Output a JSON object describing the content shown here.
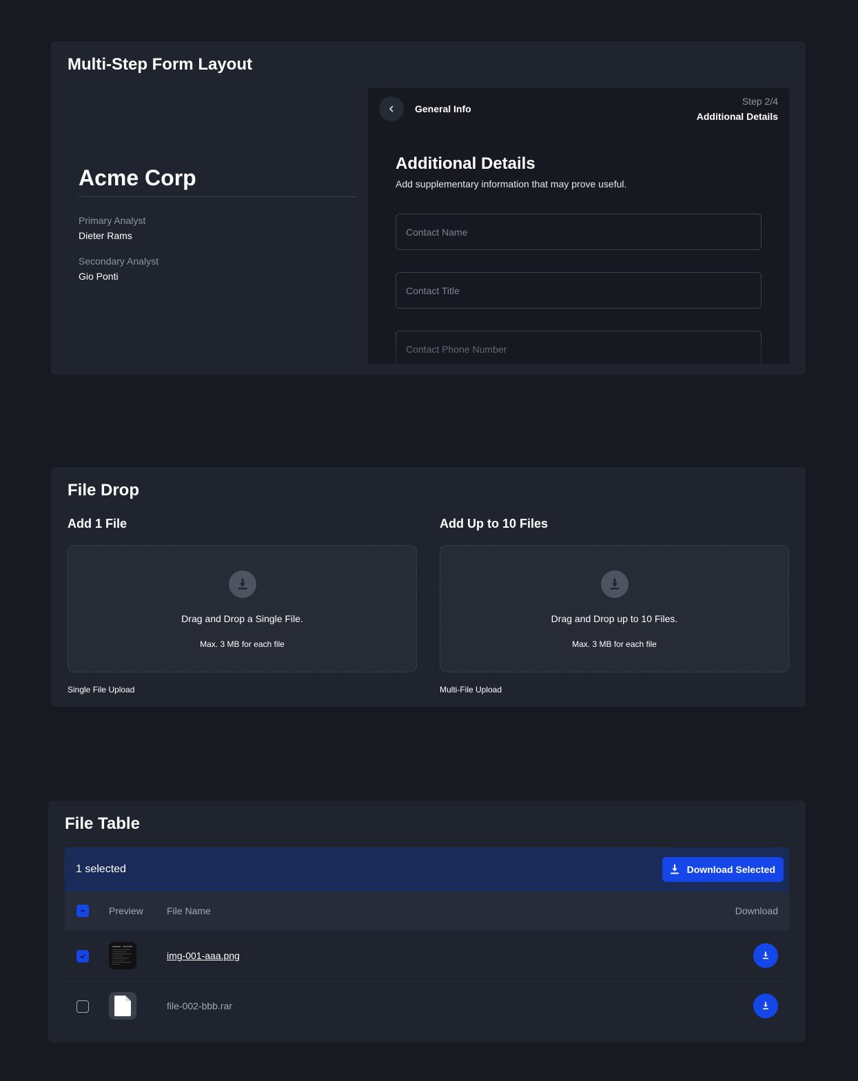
{
  "form_section": {
    "title": "Multi-Step Form Layout",
    "company": "Acme Corp",
    "analysts": [
      {
        "label": "Primary Analyst",
        "value": "Dieter Rams"
      },
      {
        "label": "Secondary Analyst",
        "value": "Gio Ponti"
      }
    ],
    "nav": {
      "back_icon": "chevron-left-icon",
      "previous_step": "General Info",
      "step_indicator": "Step 2/4",
      "current_step": "Additional Details"
    },
    "heading": "Additional Details",
    "subheading": "Add supplementary information that may prove useful.",
    "fields": [
      {
        "placeholder": "Contact Name",
        "value": ""
      },
      {
        "placeholder": "Contact Title",
        "value": ""
      },
      {
        "placeholder": "Contact Phone Number",
        "value": ""
      }
    ]
  },
  "file_drop_section": {
    "title": "File Drop",
    "zones": [
      {
        "heading": "Add 1 File",
        "icon": "download-icon",
        "main_text": "Drag and Drop a Single File.",
        "sub_text": "Max. 3 MB for each file",
        "caption": "Single File Upload"
      },
      {
        "heading": "Add Up to 10 Files",
        "icon": "download-icon",
        "main_text": "Drag and Drop up to 10 Files.",
        "sub_text": "Max. 3 MB for each file",
        "caption": "Multi-File Upload"
      }
    ]
  },
  "file_table_section": {
    "title": "File Table",
    "selection_count": "1 selected",
    "download_selected_label": "Download Selected",
    "columns": {
      "preview": "Preview",
      "file_name": "File Name",
      "download": "Download"
    },
    "header_checkbox_state": "indeterminate",
    "rows": [
      {
        "file_name": "img-001-aaa.png",
        "checked": true,
        "preview": "image-thumbnail",
        "link": true
      },
      {
        "file_name": "file-002-bbb.rar",
        "checked": false,
        "preview": "document-icon",
        "link": false
      }
    ]
  },
  "colors": {
    "page_bg": "#171a21",
    "card_bg": "#1f242e",
    "accent": "#1547e8",
    "selection_bar": "#1b2b59"
  }
}
